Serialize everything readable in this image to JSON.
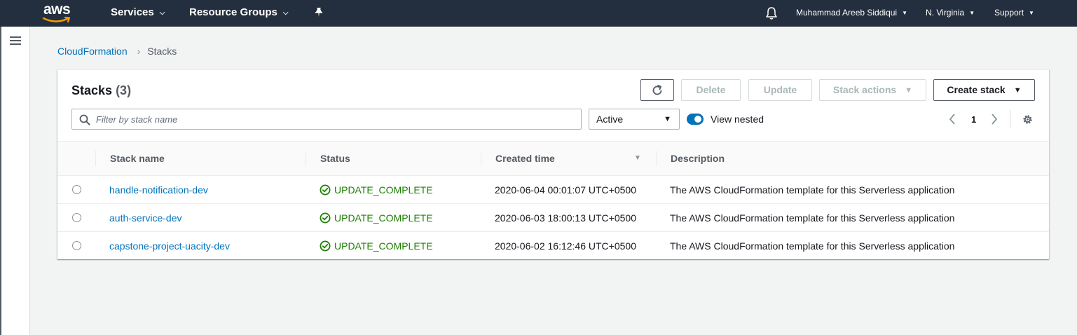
{
  "topnav": {
    "logo_text": "aws",
    "services_label": "Services",
    "resource_groups_label": "Resource Groups",
    "user_label": "Muhammad Areeb Siddiqui",
    "region_label": "N. Virginia",
    "support_label": "Support"
  },
  "breadcrumb": {
    "root": "CloudFormation",
    "current": "Stacks"
  },
  "panel": {
    "title": "Stacks",
    "count": "(3)",
    "buttons": {
      "delete": "Delete",
      "update": "Update",
      "stack_actions": "Stack actions",
      "create_stack": "Create stack"
    },
    "search_placeholder": "Filter by stack name",
    "status_filter": "Active",
    "view_nested_label": "View nested",
    "view_nested_on": true,
    "page_number": "1"
  },
  "table": {
    "columns": [
      "Stack name",
      "Status",
      "Created time",
      "Description"
    ],
    "rows": [
      {
        "name": "handle-notification-dev",
        "status": "UPDATE_COMPLETE",
        "created": "2020-06-04 00:01:07 UTC+0500",
        "description": "The AWS CloudFormation template for this Serverless application"
      },
      {
        "name": "auth-service-dev",
        "status": "UPDATE_COMPLETE",
        "created": "2020-06-03 18:00:13 UTC+0500",
        "description": "The AWS CloudFormation template for this Serverless application"
      },
      {
        "name": "capstone-project-uacity-dev",
        "status": "UPDATE_COMPLETE",
        "created": "2020-06-02 16:12:46 UTC+0500",
        "description": "The AWS CloudFormation template for this Serverless application"
      }
    ]
  },
  "colors": {
    "nav_bg": "#232f3e",
    "link": "#0073bb",
    "success": "#1d8102",
    "page_bg": "#f2f3f3"
  }
}
